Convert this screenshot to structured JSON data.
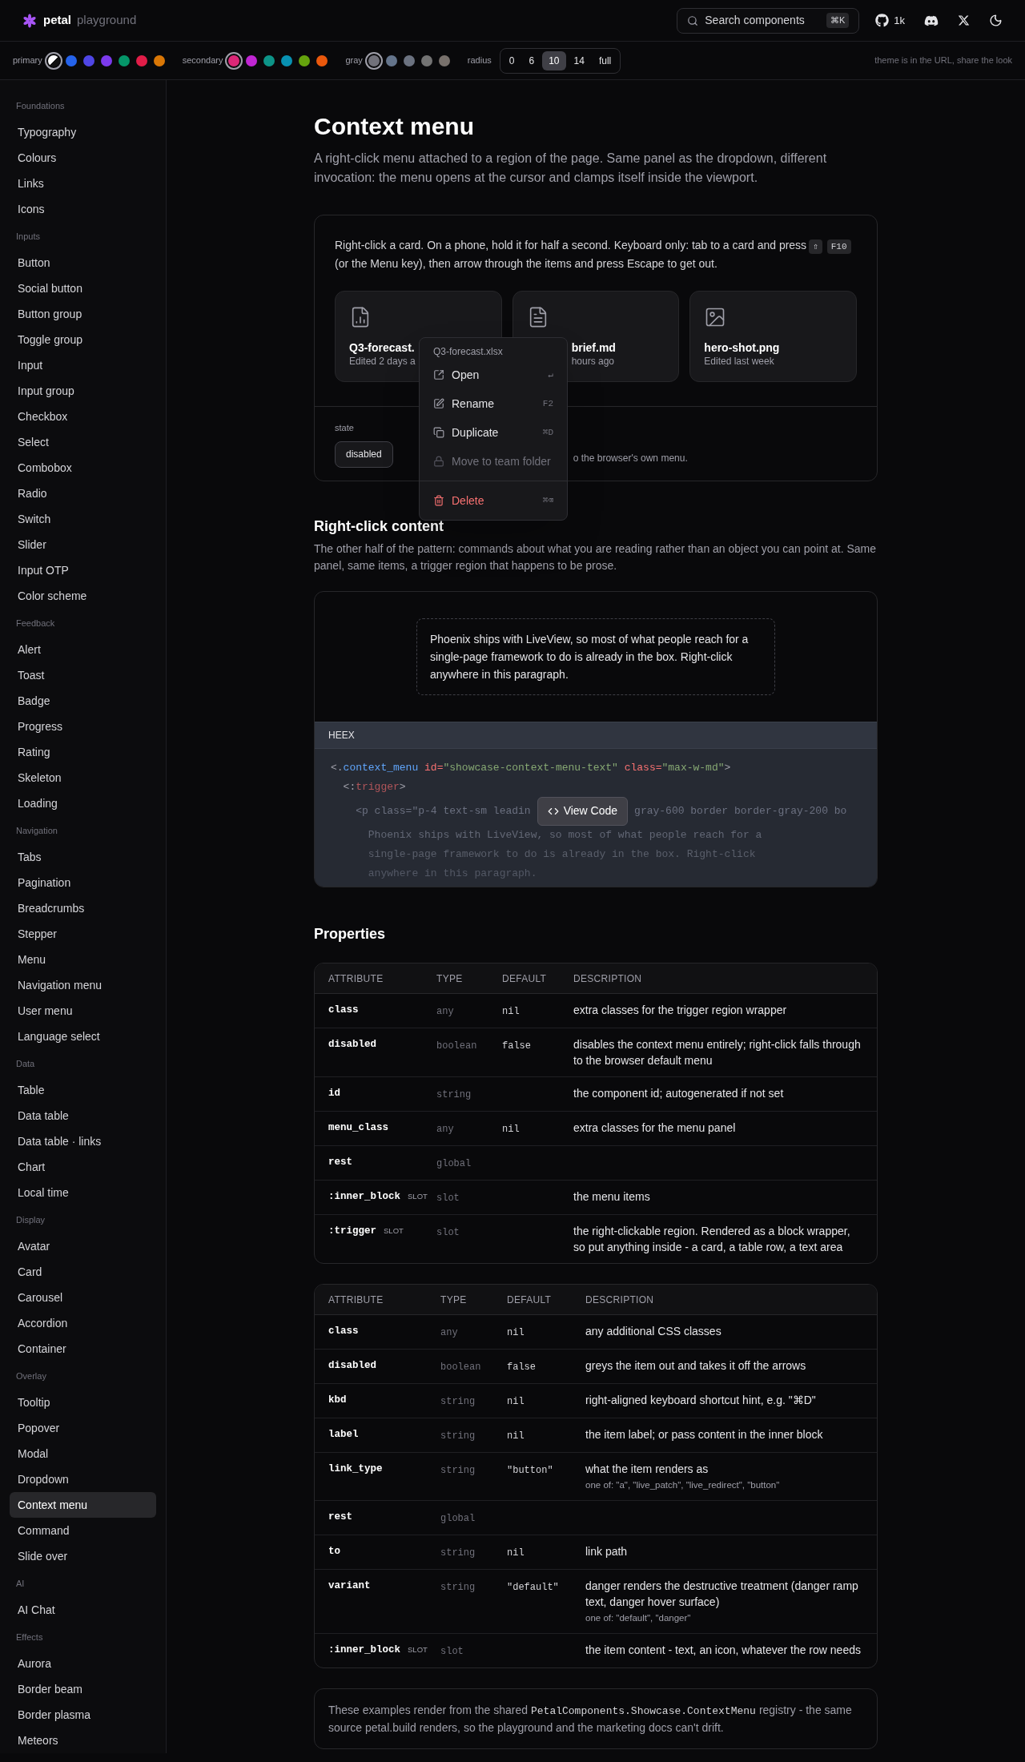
{
  "header": {
    "logo": "petal",
    "subtitle": "playground",
    "search": {
      "placeholder": "Search components",
      "shortcut": "⌘K"
    },
    "github_stars": "1k"
  },
  "theme_bar": {
    "groups": [
      {
        "label": "primary",
        "swatches": [
          {
            "kind": "split",
            "selected": true
          },
          {
            "kind": "solid",
            "color": "#2563eb",
            "selected": false
          },
          {
            "kind": "solid",
            "color": "#4f46e5",
            "selected": false
          },
          {
            "kind": "solid",
            "color": "#7c3aed",
            "selected": false
          },
          {
            "kind": "solid",
            "color": "#059669",
            "selected": false
          },
          {
            "kind": "solid",
            "color": "#e11d48",
            "selected": false
          },
          {
            "kind": "solid",
            "color": "#d97706",
            "selected": false
          }
        ]
      },
      {
        "label": "secondary",
        "swatches": [
          {
            "kind": "solid",
            "color": "#db2777",
            "selected": true
          },
          {
            "kind": "solid",
            "color": "#c026d3",
            "selected": false
          },
          {
            "kind": "solid",
            "color": "#0d9488",
            "selected": false
          },
          {
            "kind": "solid",
            "color": "#0891b2",
            "selected": false
          },
          {
            "kind": "solid",
            "color": "#65a30d",
            "selected": false
          },
          {
            "kind": "solid",
            "color": "#ea580c",
            "selected": false
          }
        ]
      },
      {
        "label": "gray",
        "swatches": [
          {
            "kind": "solid",
            "color": "#71717a",
            "selected": true
          },
          {
            "kind": "solid",
            "color": "#64748b",
            "selected": false
          },
          {
            "kind": "solid",
            "color": "#6b7280",
            "selected": false
          },
          {
            "kind": "solid",
            "color": "#737373",
            "selected": false
          },
          {
            "kind": "solid",
            "color": "#78716c",
            "selected": false
          }
        ]
      }
    ],
    "radius": {
      "label": "radius",
      "options": [
        {
          "label": "0",
          "selected": false
        },
        {
          "label": "6",
          "selected": false
        },
        {
          "label": "10",
          "selected": true
        },
        {
          "label": "14",
          "selected": false
        },
        {
          "label": "full",
          "selected": false
        }
      ]
    },
    "hint": "theme is in the URL, share the look"
  },
  "sidebar": {
    "sections": [
      {
        "heading": "Foundations",
        "items": [
          {
            "label": "Typography",
            "selected": false
          },
          {
            "label": "Colours",
            "selected": false
          },
          {
            "label": "Links",
            "selected": false
          },
          {
            "label": "Icons",
            "selected": false
          }
        ]
      },
      {
        "heading": "Inputs",
        "items": [
          {
            "label": "Button",
            "selected": false
          },
          {
            "label": "Social button",
            "selected": false
          },
          {
            "label": "Button group",
            "selected": false
          },
          {
            "label": "Toggle group",
            "selected": false
          },
          {
            "label": "Input",
            "selected": false
          },
          {
            "label": "Input group",
            "selected": false
          },
          {
            "label": "Checkbox",
            "selected": false
          },
          {
            "label": "Select",
            "selected": false
          },
          {
            "label": "Combobox",
            "selected": false
          },
          {
            "label": "Radio",
            "selected": false
          },
          {
            "label": "Switch",
            "selected": false
          },
          {
            "label": "Slider",
            "selected": false
          },
          {
            "label": "Input OTP",
            "selected": false
          },
          {
            "label": "Color scheme",
            "selected": false
          }
        ]
      },
      {
        "heading": "Feedback",
        "items": [
          {
            "label": "Alert",
            "selected": false
          },
          {
            "label": "Toast",
            "selected": false
          },
          {
            "label": "Badge",
            "selected": false
          },
          {
            "label": "Progress",
            "selected": false
          },
          {
            "label": "Rating",
            "selected": false
          },
          {
            "label": "Skeleton",
            "selected": false
          },
          {
            "label": "Loading",
            "selected": false
          }
        ]
      },
      {
        "heading": "Navigation",
        "items": [
          {
            "label": "Tabs",
            "selected": false
          },
          {
            "label": "Pagination",
            "selected": false
          },
          {
            "label": "Breadcrumbs",
            "selected": false
          },
          {
            "label": "Stepper",
            "selected": false
          },
          {
            "label": "Menu",
            "selected": false
          },
          {
            "label": "Navigation menu",
            "selected": false
          },
          {
            "label": "User menu",
            "selected": false
          },
          {
            "label": "Language select",
            "selected": false
          }
        ]
      },
      {
        "heading": "Data",
        "items": [
          {
            "label": "Table",
            "selected": false
          },
          {
            "label": "Data table",
            "selected": false
          },
          {
            "label": "Data table · links",
            "selected": false
          },
          {
            "label": "Chart",
            "selected": false
          },
          {
            "label": "Local time",
            "selected": false
          }
        ]
      },
      {
        "heading": "Display",
        "items": [
          {
            "label": "Avatar",
            "selected": false
          },
          {
            "label": "Card",
            "selected": false
          },
          {
            "label": "Carousel",
            "selected": false
          },
          {
            "label": "Accordion",
            "selected": false
          },
          {
            "label": "Container",
            "selected": false
          }
        ]
      },
      {
        "heading": "Overlay",
        "items": [
          {
            "label": "Tooltip",
            "selected": false
          },
          {
            "label": "Popover",
            "selected": false
          },
          {
            "label": "Modal",
            "selected": false
          },
          {
            "label": "Dropdown",
            "selected": false
          },
          {
            "label": "Context menu",
            "selected": true
          },
          {
            "label": "Command",
            "selected": false
          },
          {
            "label": "Slide over",
            "selected": false
          }
        ]
      },
      {
        "heading": "AI",
        "items": [
          {
            "label": "AI Chat",
            "selected": false
          }
        ]
      },
      {
        "heading": "Effects",
        "items": [
          {
            "label": "Aurora",
            "selected": false
          },
          {
            "label": "Border beam",
            "selected": false
          },
          {
            "label": "Border plasma",
            "selected": false
          },
          {
            "label": "Meteors",
            "selected": false
          }
        ]
      }
    ]
  },
  "page": {
    "title": "Context menu",
    "description": "A right-click menu attached to a region of the page. Same panel as the dropdown, different invocation: the menu opens at the cursor and clamps itself inside the viewport."
  },
  "demo": {
    "instructions": {
      "before": "Right-click a card. On a phone, hold it for half a second. Keyboard only: tab to a card and press",
      "keys": [
        "⇧",
        "F10"
      ],
      "after": "(or the Menu key), then arrow through the items and press Escape to get out."
    },
    "cards": [
      {
        "title": "Q3-forecast.",
        "subtitle": "Edited 2 days a"
      },
      {
        "title": "brief.md",
        "subtitle": "hours ago"
      },
      {
        "title": "hero-shot.png",
        "subtitle": "Edited last week"
      }
    ],
    "state": {
      "label": "state",
      "button": "disabled",
      "hint": "o the browser's own menu."
    },
    "menu": {
      "title": "Q3-forecast.xlsx",
      "items": [
        {
          "kind": "item",
          "label": "Open",
          "kbd": "↵",
          "disabled": false
        },
        {
          "kind": "item",
          "label": "Rename",
          "kbd": "F2",
          "disabled": false
        },
        {
          "kind": "item",
          "label": "Duplicate",
          "kbd": "⌘D",
          "disabled": false
        },
        {
          "kind": "item",
          "label": "Move to team folder",
          "disabled": true
        },
        {
          "kind": "separator"
        },
        {
          "kind": "danger",
          "label": "Delete",
          "kbd": "⌘⌫",
          "disabled": false
        }
      ]
    }
  },
  "section2": {
    "title": "Right-click content",
    "description": "The other half of the pattern: commands about what you are reading rather than an object you can point at. Same panel, same items, a trigger region that happens to be prose.",
    "demo_text": "Phoenix ships with LiveView, so most of what people reach for a single-page framework to do is already in the box. Right-click anywhere in this paragraph.",
    "code": {
      "language": "HEEX",
      "button": "View Code",
      "lines": [
        {
          "kind": "tokens",
          "tokens": [
            {
              "kind": "punct",
              "text": "<."
            },
            {
              "kind": "tag",
              "text": "context_menu"
            },
            {
              "kind": "attr",
              "text": " id="
            },
            {
              "kind": "string",
              "text": "\"showcase-context-menu-text\""
            },
            {
              "kind": "attr",
              "text": " class="
            },
            {
              "kind": "string",
              "text": "\"max-w-md\""
            },
            {
              "kind": "punct",
              "text": ">"
            }
          ]
        },
        {
          "kind": "tokens",
          "tokens": [
            {
              "kind": "punct",
              "text": "  <:"
            },
            {
              "kind": "attr",
              "text": "trigger"
            },
            {
              "kind": "punct",
              "text": ">"
            }
          ]
        },
        {
          "kind": "split",
          "before": "    <p class=\"p-4 text-sm leadin",
          "after": "gray-600 border border-gray-200 bo"
        },
        {
          "kind": "plain",
          "text": "      Phoenix ships with LiveView, so most of what people reach for a"
        },
        {
          "kind": "plain",
          "text": "      single-page framework to do is already in the box. Right-click"
        },
        {
          "kind": "plain",
          "text": "      anywhere in this paragraph."
        }
      ]
    }
  },
  "properties": {
    "title": "Properties",
    "tables": [
      {
        "columns": [
          "ATTRIBUTE",
          "TYPE",
          "DEFAULT",
          "DESCRIPTION"
        ],
        "rows": [
          {
            "attribute": "class",
            "type": "any",
            "default": "nil",
            "description": "extra classes for the trigger region wrapper"
          },
          {
            "attribute": "disabled",
            "type": "boolean",
            "default": "false",
            "description": "disables the context menu entirely; right-click falls through to the browser default menu"
          },
          {
            "attribute": "id",
            "type": "string",
            "description": "the component id; autogenerated if not set"
          },
          {
            "attribute": "menu_class",
            "type": "any",
            "default": "nil",
            "description": "extra classes for the menu panel"
          },
          {
            "attribute": "rest",
            "type": "global"
          },
          {
            "attribute": ":inner_block",
            "badge": "SLOT",
            "type": "slot",
            "description": "the menu items"
          },
          {
            "attribute": ":trigger",
            "badge": "SLOT",
            "type": "slot",
            "description": "the right-clickable region. Rendered as a block wrapper, so put anything inside - a card, a table row, a text area"
          }
        ]
      },
      {
        "columns": [
          "ATTRIBUTE",
          "TYPE",
          "DEFAULT",
          "DESCRIPTION"
        ],
        "rows": [
          {
            "attribute": "class",
            "type": "any",
            "default": "nil",
            "description": "any additional CSS classes"
          },
          {
            "attribute": "disabled",
            "type": "boolean",
            "default": "false",
            "description": "greys the item out and takes it off the arrows"
          },
          {
            "attribute": "kbd",
            "type": "string",
            "default": "nil",
            "description": "right-aligned keyboard shortcut hint, e.g. \"⌘D\""
          },
          {
            "attribute": "label",
            "type": "string",
            "default": "nil",
            "description": "the item label; or pass content in the inner block"
          },
          {
            "attribute": "link_type",
            "type": "string",
            "default": "\"button\"",
            "description": "what the item renders as",
            "note": "one of: \"a\", \"live_patch\", \"live_redirect\", \"button\""
          },
          {
            "attribute": "rest",
            "type": "global"
          },
          {
            "attribute": "to",
            "type": "string",
            "default": "nil",
            "description": "link path"
          },
          {
            "attribute": "variant",
            "type": "string",
            "default": "\"default\"",
            "description": "danger renders the destructive treatment (danger ramp text, danger hover surface)",
            "note": "one of: \"default\", \"danger\""
          },
          {
            "attribute": ":inner_block",
            "badge": "SLOT",
            "type": "slot",
            "description": "the item content - text, an icon, whatever the row needs"
          }
        ]
      }
    ]
  },
  "footer_note": {
    "before": "These examples render from the shared",
    "code": "PetalComponents.Showcase.ContextMenu",
    "after": "registry - the same source petal.build renders, so the playground and the marketing docs can't drift."
  }
}
